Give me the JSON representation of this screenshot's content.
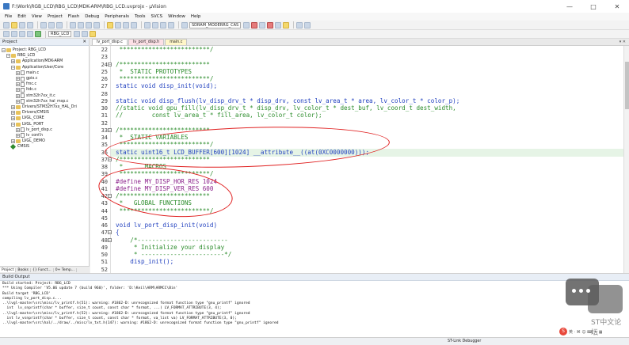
{
  "window": {
    "title": "F:\\Work\\RGB_LCD\\RBG_LCD\\MDK-ARM\\RBG_LCD.uvprojx - µVision",
    "controls": [
      "—",
      "□",
      "✕"
    ]
  },
  "menu": [
    "File",
    "Edit",
    "View",
    "Project",
    "Flash",
    "Debug",
    "Peripherals",
    "Tools",
    "SVCS",
    "Window",
    "Help"
  ],
  "toolbar": {
    "target_name": "SDRAM_MODERRG_CAS",
    "target2": "RBG_LCD"
  },
  "project": {
    "header": "Project",
    "close": "✕",
    "tree": [
      {
        "label": "Project: RBG_LCD",
        "indent": 0,
        "kind": "root",
        "exp": "−"
      },
      {
        "label": "RBG_LCD",
        "indent": 1,
        "kind": "folder",
        "exp": "−"
      },
      {
        "label": "Application/MDK-ARM",
        "indent": 2,
        "kind": "folder",
        "exp": "+"
      },
      {
        "label": "Application/User/Core",
        "indent": 2,
        "kind": "folder",
        "exp": "−"
      },
      {
        "label": "main.c",
        "indent": 3,
        "kind": "file",
        "exp": "+"
      },
      {
        "label": "gpio.c",
        "indent": 3,
        "kind": "file",
        "exp": "+"
      },
      {
        "label": "fmc.c",
        "indent": 3,
        "kind": "file",
        "exp": "+"
      },
      {
        "label": "ltdc.c",
        "indent": 3,
        "kind": "file",
        "exp": "+"
      },
      {
        "label": "stm32h7xx_it.c",
        "indent": 3,
        "kind": "file",
        "exp": "+"
      },
      {
        "label": "stm32h7xx_hal_msp.c",
        "indent": 3,
        "kind": "file",
        "exp": "+"
      },
      {
        "label": "Drivers/STM32H7xx_HAL_Dri",
        "indent": 2,
        "kind": "folder",
        "exp": "+"
      },
      {
        "label": "Drivers/CMSIS",
        "indent": 2,
        "kind": "folder",
        "exp": "+"
      },
      {
        "label": "LVGL_CORE",
        "indent": 2,
        "kind": "folder",
        "exp": "+"
      },
      {
        "label": "LVGL_PORT",
        "indent": 2,
        "kind": "folder",
        "exp": "−"
      },
      {
        "label": "lv_port_disp.c",
        "indent": 3,
        "kind": "file",
        "exp": "+"
      },
      {
        "label": "lv_conf.h",
        "indent": 3,
        "kind": "file",
        "exp": "+"
      },
      {
        "label": "LVGL_DEMO",
        "indent": 2,
        "kind": "folder",
        "exp": "+"
      },
      {
        "label": "CMSIS",
        "indent": 2,
        "kind": "diamond",
        "exp": ""
      }
    ],
    "bottom_tabs": [
      "Project",
      "Books",
      "{} Funct...",
      "0+ Temp..."
    ]
  },
  "editor": {
    "tabs": [
      {
        "label": "lv_port_disp.c",
        "style": "yellow"
      },
      {
        "label": "lv_port_disp.h",
        "style": "pink"
      },
      {
        "label": "main.c",
        "style": "yellow"
      }
    ],
    "tabs_right": "▾ ✕",
    "lines": [
      {
        "n": "22",
        "fold": "",
        "cls": "c-comment",
        "text": " *************************/"
      },
      {
        "n": "23",
        "fold": "",
        "cls": "c-plain",
        "text": ""
      },
      {
        "n": "24",
        "fold": "⊟",
        "cls": "c-comment",
        "text": "/*************************"
      },
      {
        "n": "25",
        "fold": "",
        "cls": "c-comment",
        "text": " *  STATIC PROTOTYPES"
      },
      {
        "n": "26",
        "fold": "",
        "cls": "c-comment",
        "text": " *************************/"
      },
      {
        "n": "27",
        "fold": "",
        "cls": "c-kw",
        "text": "static void disp_init(void);"
      },
      {
        "n": "28",
        "fold": "",
        "cls": "c-plain",
        "text": ""
      },
      {
        "n": "29",
        "fold": "",
        "cls": "c-kw",
        "text": "static void disp_flush(lv_disp_drv_t * disp_drv, const lv_area_t * area, lv_color_t * color_p);"
      },
      {
        "n": "30",
        "fold": "",
        "cls": "c-comment",
        "text": "//static void gpu_fill(lv_disp_drv_t * disp_drv, lv_color_t * dest_buf, lv_coord_t dest_width,"
      },
      {
        "n": "31",
        "fold": "",
        "cls": "c-comment",
        "text": "//        const lv_area_t * fill_area, lv_color_t color);"
      },
      {
        "n": "32",
        "fold": "",
        "cls": "c-plain",
        "text": ""
      },
      {
        "n": "33",
        "fold": "⊟",
        "cls": "c-comment",
        "text": "/*************************"
      },
      {
        "n": "34",
        "fold": "",
        "cls": "c-comment",
        "text": " *  STATIC VARIABLES"
      },
      {
        "n": "35",
        "fold": "",
        "cls": "c-comment",
        "text": " *************************/"
      },
      {
        "n": "36",
        "fold": "",
        "cls": "c-kw",
        "text": "static uint16_t LCD_BUFFER[600][1024] __attribute__((at(0XC0000000)));",
        "highlight": true
      },
      {
        "n": "37",
        "fold": "⊟",
        "cls": "c-comment",
        "text": "/*************************"
      },
      {
        "n": "38",
        "fold": "",
        "cls": "c-comment",
        "text": " *      MACROS"
      },
      {
        "n": "39",
        "fold": "",
        "cls": "c-comment",
        "text": " *************************/"
      },
      {
        "n": "40",
        "fold": "",
        "cls": "c-pre",
        "text": "#define MY_DISP_HOR_RES 1024"
      },
      {
        "n": "41",
        "fold": "",
        "cls": "c-pre",
        "text": "#define MY_DISP_VER_RES 600"
      },
      {
        "n": "42",
        "fold": "⊟",
        "cls": "c-comment",
        "text": "/*************************"
      },
      {
        "n": "43",
        "fold": "",
        "cls": "c-comment",
        "text": " *   GLOBAL FUNCTIONS"
      },
      {
        "n": "44",
        "fold": "",
        "cls": "c-comment",
        "text": " *************************/"
      },
      {
        "n": "45",
        "fold": "",
        "cls": "c-plain",
        "text": ""
      },
      {
        "n": "46",
        "fold": "",
        "cls": "c-kw",
        "text": "void lv_port_disp_init(void)"
      },
      {
        "n": "47",
        "fold": "⊟",
        "cls": "c-kw",
        "text": "{"
      },
      {
        "n": "48",
        "fold": "⊟",
        "cls": "c-comment",
        "text": "    /*-------------------------"
      },
      {
        "n": "49",
        "fold": "",
        "cls": "c-comment",
        "text": "     * Initialize your display"
      },
      {
        "n": "50",
        "fold": "",
        "cls": "c-comment",
        "text": "     * -----------------------*/"
      },
      {
        "n": "51",
        "fold": "",
        "cls": "c-kw",
        "text": "    disp_init();"
      },
      {
        "n": "52",
        "fold": "",
        "cls": "c-plain",
        "text": ""
      }
    ]
  },
  "build": {
    "header": "Build Output",
    "lines": [
      "Build started: Project: RBG_LCD",
      "*** Using Compiler 'V5.06 update 7 (build 960)', folder: 'D:\\Keil\\ARM\\ARMCC\\Bin'",
      "Build target 'RBG_LCD'",
      "compiling lv_port_disp.c...",
      "..\\lvgl-master\\src\\misc/lv_printf.h(51): warning: #1862-D: unrecognized format function type \"gnu_printf\" ignored",
      "  int  lv_snprintf(char * buffer, size_t count, const char * format, ...) LV_FORMAT_ATTRIBUTE(3, 4);",
      "..\\lvgl-master\\src\\misc/lv_printf.h(52): warning: #1862-D: unrecognized format function type \"gnu_printf\" ignored",
      "  int lv_vsnprintf(char * buffer, size_t count, const char * format, va_list va) LV_FORMAT_ATTRIBUTE(3, 0);",
      "..\\lvgl-master\\src\\hal/../draw/../misc/lv_txt.h(147): warning: #1862-D: unrecognized format function type \"gnu_printf\" ignored"
    ]
  },
  "status": {
    "debugger": "ST-Link Debugger"
  },
  "watermark": {
    "text": "ST中文论坛",
    "badge": "S",
    "tray": "英 · ⌘ ☺ ⌨ ✎ ▦"
  }
}
